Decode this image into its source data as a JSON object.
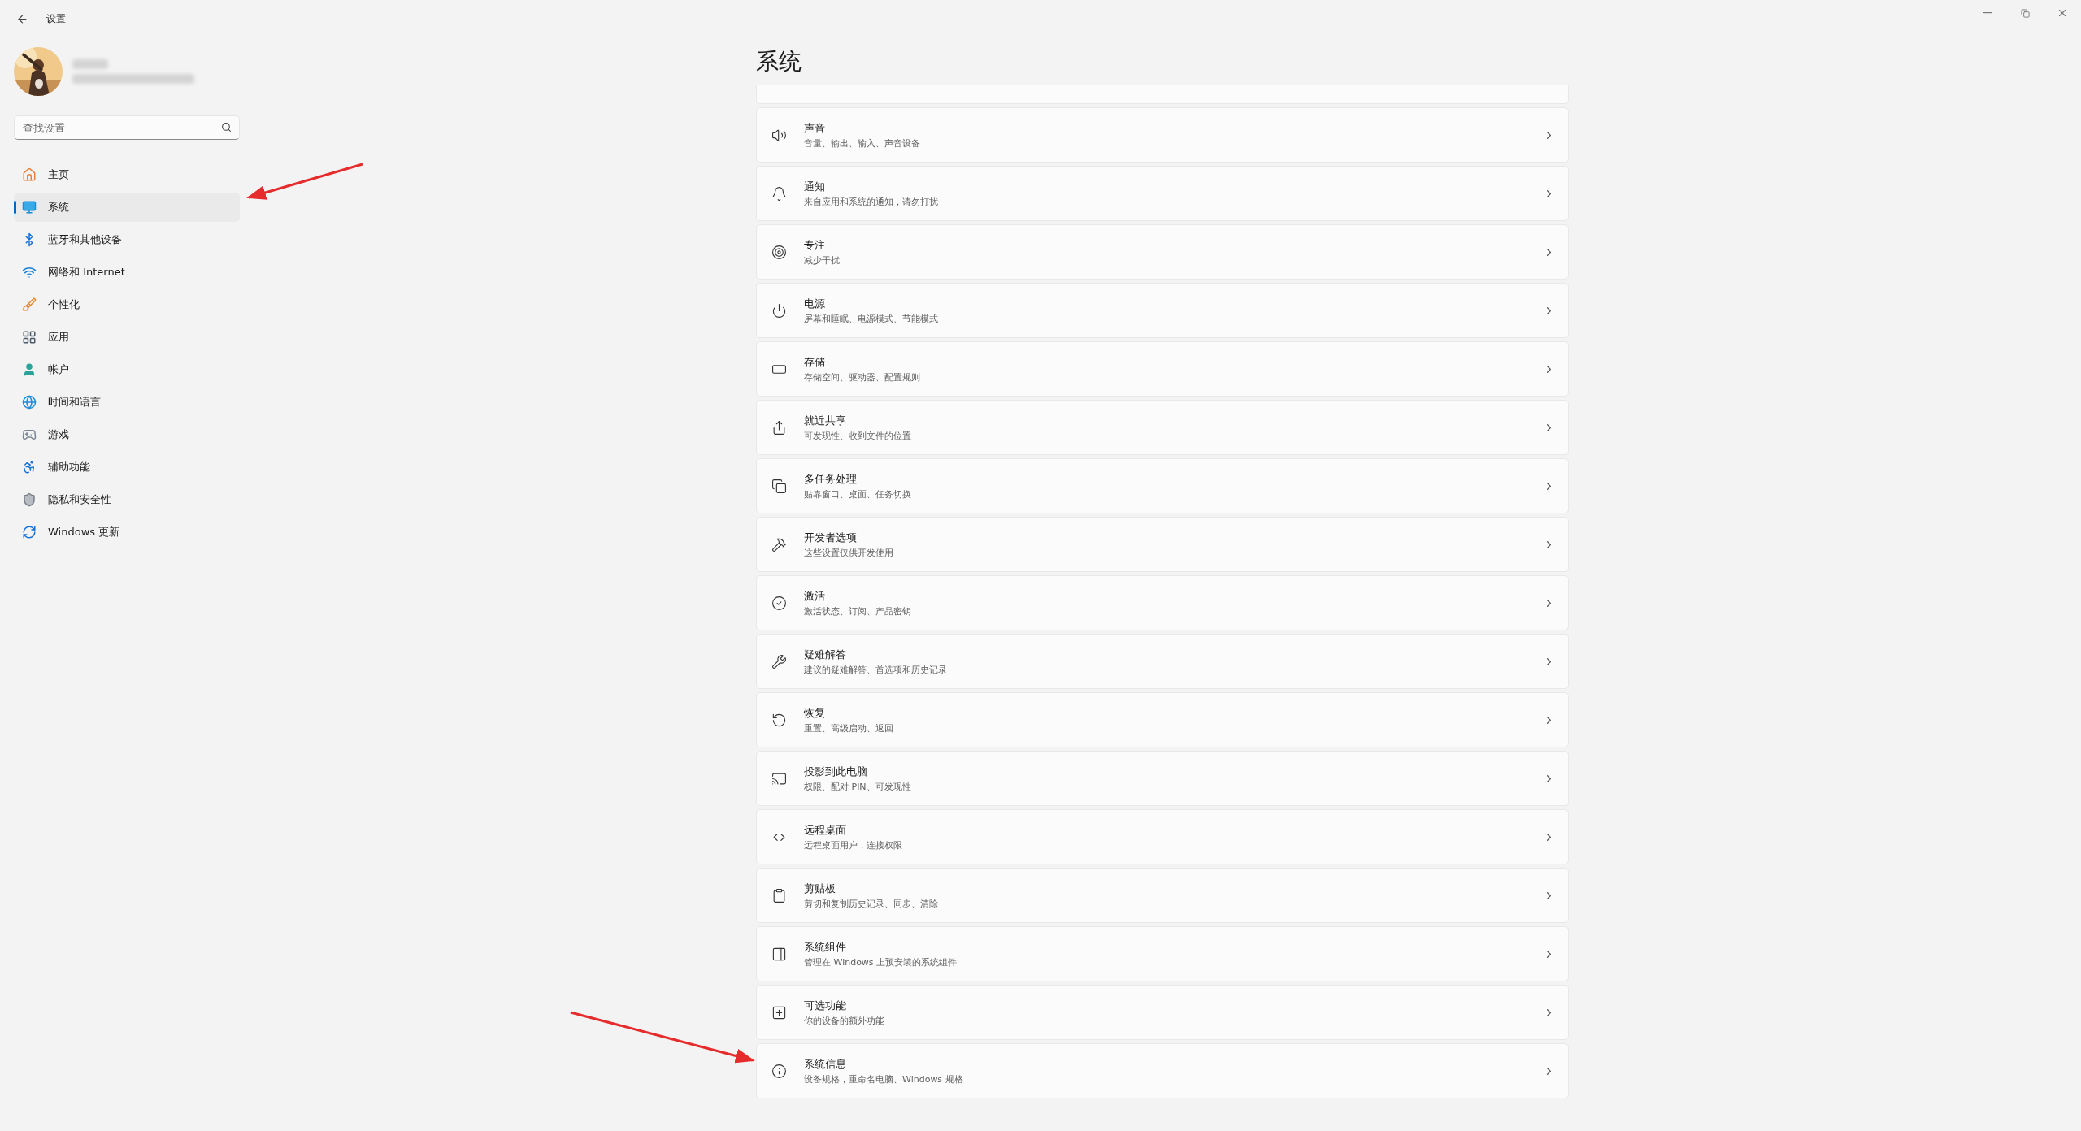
{
  "window": {
    "title": "设置"
  },
  "search": {
    "placeholder": "查找设置"
  },
  "nav": [
    {
      "label": "主页",
      "selected": false
    },
    {
      "label": "系统",
      "selected": true
    },
    {
      "label": "蓝牙和其他设备",
      "selected": false
    },
    {
      "label": "网络和 Internet",
      "selected": false
    },
    {
      "label": "个性化",
      "selected": false
    },
    {
      "label": "应用",
      "selected": false
    },
    {
      "label": "帐户",
      "selected": false
    },
    {
      "label": "时间和语言",
      "selected": false
    },
    {
      "label": "游戏",
      "selected": false
    },
    {
      "label": "辅助功能",
      "selected": false
    },
    {
      "label": "隐私和安全性",
      "selected": false
    },
    {
      "label": "Windows 更新",
      "selected": false
    }
  ],
  "page": {
    "title": "系统"
  },
  "settings": [
    {
      "title": "声音",
      "description": "音量、输出、输入、声音设备"
    },
    {
      "title": "通知",
      "description": "来自应用和系统的通知，请勿打扰"
    },
    {
      "title": "专注",
      "description": "减少干扰"
    },
    {
      "title": "电源",
      "description": "屏幕和睡眠、电源模式、节能模式"
    },
    {
      "title": "存储",
      "description": "存储空间、驱动器、配置规则"
    },
    {
      "title": "就近共享",
      "description": "可发现性、收到文件的位置"
    },
    {
      "title": "多任务处理",
      "description": "贴靠窗口、桌面、任务切换"
    },
    {
      "title": "开发者选项",
      "description": "这些设置仅供开发使用"
    },
    {
      "title": "激活",
      "description": "激活状态、订阅、产品密钥"
    },
    {
      "title": "疑难解答",
      "description": "建议的疑难解答、首选项和历史记录"
    },
    {
      "title": "恢复",
      "description": "重置、高级启动、返回"
    },
    {
      "title": "投影到此电脑",
      "description": "权限、配对 PIN、可发现性"
    },
    {
      "title": "远程桌面",
      "description": "远程桌面用户，连接权限"
    },
    {
      "title": "剪贴板",
      "description": "剪切和复制历史记录、同步、清除"
    },
    {
      "title": "系统组件",
      "description": "管理在 Windows 上预安装的系统组件"
    },
    {
      "title": "可选功能",
      "description": "你的设备的额外功能"
    },
    {
      "title": "系统信息",
      "description": "设备规格，重命名电脑、Windows 规格"
    }
  ]
}
